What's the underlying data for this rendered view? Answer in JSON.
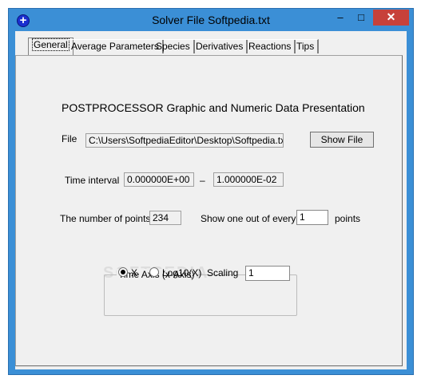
{
  "window": {
    "title": "Solver File  Softpedia.txt",
    "minimize": "–",
    "maximize": "□",
    "close": "✕"
  },
  "tabs": [
    {
      "label": "General",
      "active": true
    },
    {
      "label": "Average Parameters",
      "active": false
    },
    {
      "label": "Species",
      "active": false
    },
    {
      "label": "Derivatives",
      "active": false
    },
    {
      "label": "Reactions",
      "active": false
    },
    {
      "label": "Tips",
      "active": false
    }
  ],
  "general": {
    "heading": "POSTPROCESSOR  Graphic and Numeric Data Presentation",
    "file_label": "File",
    "file_value": "C:\\Users\\SoftpediaEditor\\Desktop\\Softpedia.txt",
    "show_file_button": "Show File",
    "time_interval_label": "Time interval",
    "time_start": "0.000000E+00",
    "time_separator": "–",
    "time_end": "1.000000E-02",
    "points_label": "The number of points",
    "points_value": "234",
    "show_one_label": "Show one out of every",
    "show_one_value": "1",
    "points_suffix": "points",
    "time_axis": {
      "title": "Time Axis (x-Axis)",
      "option_x": "X",
      "option_log": "Log10(X)",
      "selected": "X",
      "scaling_label": "Scaling",
      "scaling_value": "1"
    }
  }
}
